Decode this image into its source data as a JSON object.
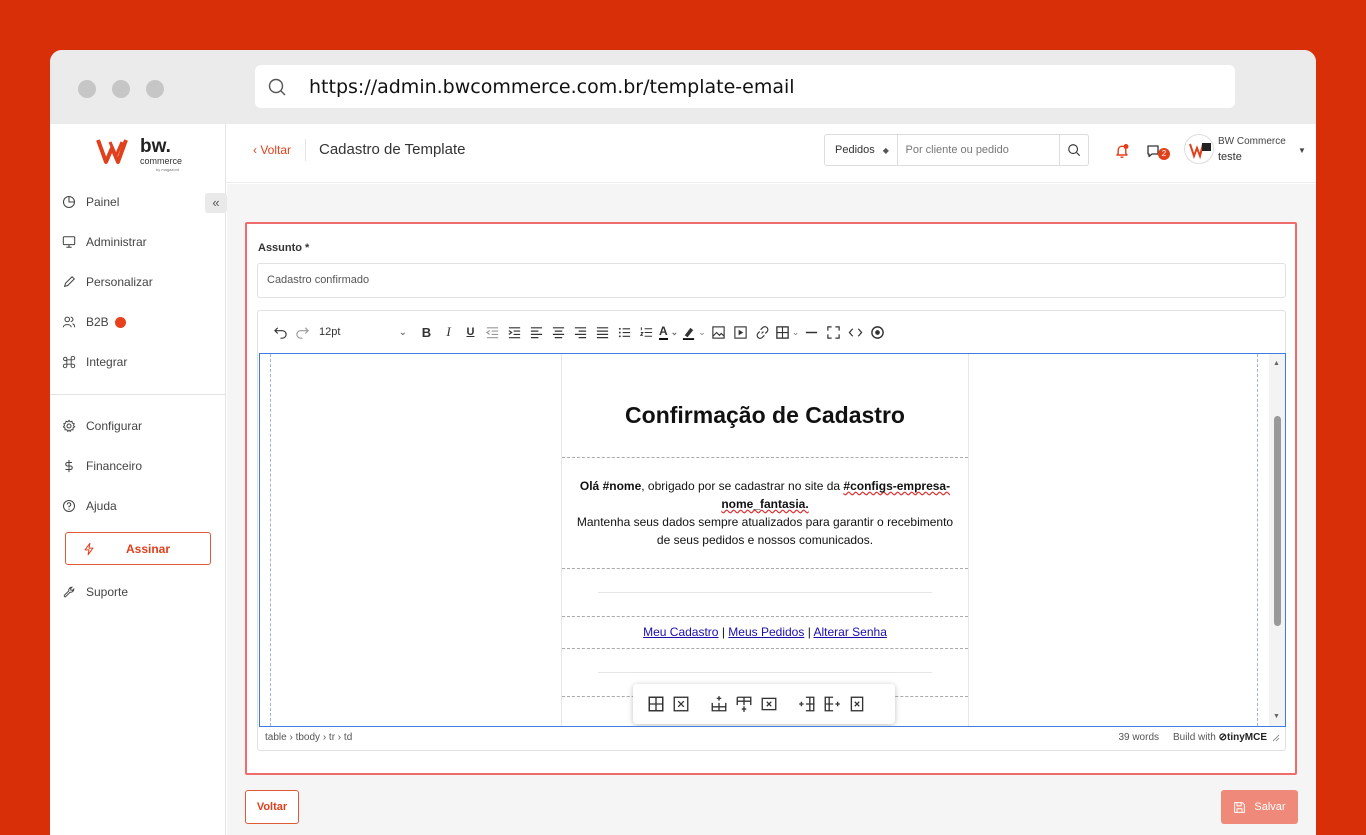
{
  "browser": {
    "url": "https://admin.bwcommerce.com.br/template-email"
  },
  "brand": {
    "logo_text": "bw.",
    "logo_sub": "commerce",
    "logo_by": "by magazord",
    "accent": "#e0401c",
    "background": "#d92f08"
  },
  "sidebar": {
    "collapse_label": "«",
    "items": [
      {
        "label": "Painel",
        "icon": "clock-icon"
      },
      {
        "label": "Administrar",
        "icon": "monitor-icon"
      },
      {
        "label": "Personalizar",
        "icon": "pen-icon"
      },
      {
        "label": "B2B",
        "icon": "users-icon"
      },
      {
        "label": "Integrar",
        "icon": "command-icon"
      },
      {
        "label": "Configurar",
        "icon": "gear-icon"
      },
      {
        "label": "Financeiro",
        "icon": "dollar-icon"
      },
      {
        "label": "Ajuda",
        "icon": "help-icon"
      },
      {
        "label": "Suporte",
        "icon": "wrench-icon"
      }
    ],
    "assinar_label": "Assinar"
  },
  "topbar": {
    "back_label": "‹ Voltar",
    "page_title": "Cadastro de Template",
    "search_select": "Pedidos",
    "search_placeholder": "Por cliente ou pedido",
    "chat_count": "2",
    "user_name": "BW Commerce",
    "user_sub": "teste"
  },
  "form": {
    "subject_label": "Assunto *",
    "subject_value": "Cadastro confirmado",
    "font_size": "12pt"
  },
  "email": {
    "title": "Confirmação de Cadastro",
    "greeting": "Olá",
    "name_var": "#nome",
    "body_1": ", obrigado por se cadastrar no site da",
    "company_var": "#configs-empresa-nome_fantasia.",
    "body_2": "Mantenha seus dados sempre atualizados para garantir o recebimento de seus pedidos e nossos comunicados.",
    "link_1": "Meu Cadastro",
    "link_2": "Meus Pedidos",
    "link_3": "Alterar Senha",
    "link_sep": "|"
  },
  "status": {
    "path": "table › tbody › tr › td",
    "words": "39 words",
    "build": "Build with",
    "brand": "tinyMCE"
  },
  "actions": {
    "back_label": "Voltar",
    "save_label": "Salvar"
  }
}
